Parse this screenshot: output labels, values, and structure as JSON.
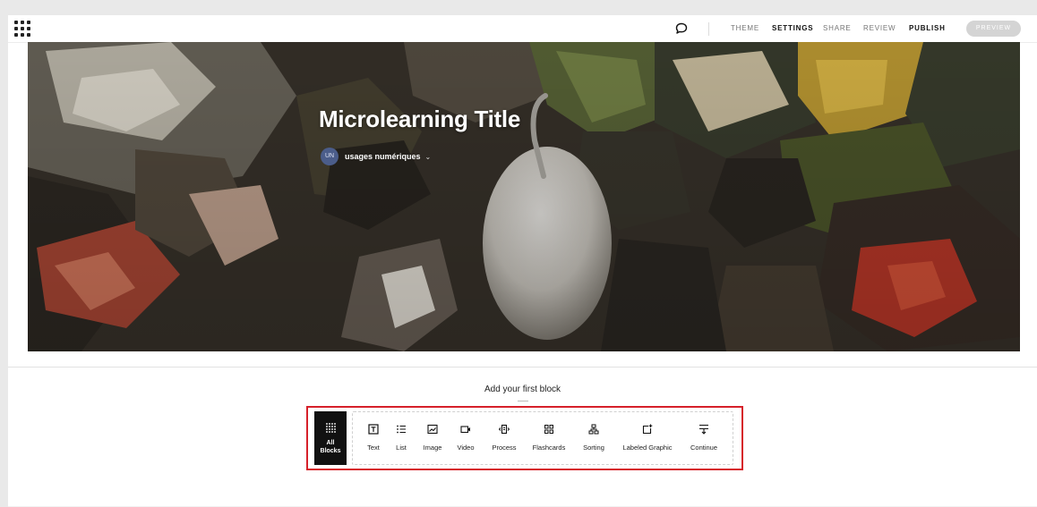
{
  "topbar": {
    "nav": [
      {
        "id": "theme",
        "label": "THEME"
      },
      {
        "id": "settings",
        "label": "SETTINGS"
      },
      {
        "id": "share",
        "label": "SHARE"
      },
      {
        "id": "review",
        "label": "REVIEW"
      },
      {
        "id": "publish",
        "label": "PUBLISH"
      }
    ],
    "preview_label": "PREVIEW",
    "icons": {
      "menu": "grid-menu-icon",
      "comment": "comment-icon"
    }
  },
  "hero": {
    "title": "Microlearning Title",
    "author_initials": "UN",
    "author_name": "usages numériques",
    "author_chevron": "⌄"
  },
  "blocks": {
    "heading": "Add your first block",
    "all_blocks_label_1": "All",
    "all_blocks_label_2": "Blocks",
    "items": [
      {
        "label": "Text",
        "icon": "text-icon"
      },
      {
        "label": "List",
        "icon": "list-icon"
      },
      {
        "label": "Image",
        "icon": "image-icon"
      },
      {
        "label": "Video",
        "icon": "video-icon"
      },
      {
        "label": "Process",
        "icon": "process-icon"
      },
      {
        "label": "Flashcards",
        "icon": "flashcards-icon"
      },
      {
        "label": "Sorting",
        "icon": "sorting-icon"
      },
      {
        "label": "Labeled Graphic",
        "icon": "labeled-graphic-icon"
      },
      {
        "label": "Continue",
        "icon": "continue-icon"
      }
    ]
  },
  "colors": {
    "highlight": "#d6202a",
    "avatar": "#4b5d8a",
    "preview_bg": "#d4d4d4",
    "all_blocks_bg": "#111111"
  }
}
